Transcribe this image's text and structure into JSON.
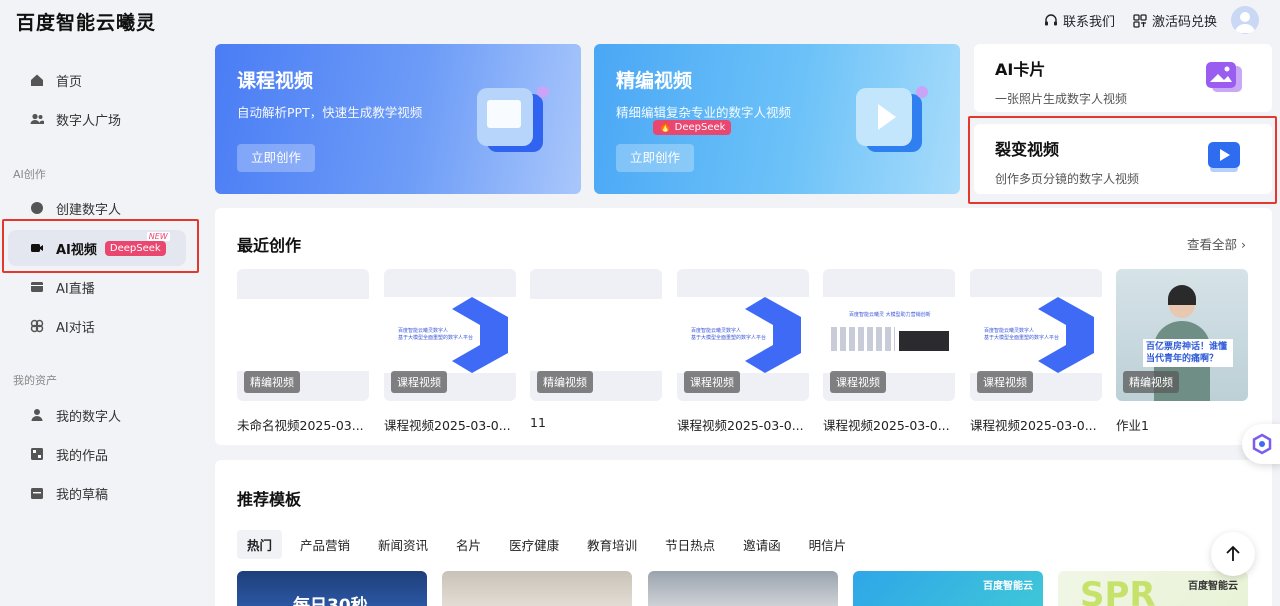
{
  "header": {
    "logo": "百度智能云曦灵",
    "contact": "联系我们",
    "redeem": "激活码兑换"
  },
  "sidebar": {
    "items": [
      {
        "label": "首页",
        "icon": "home-icon"
      },
      {
        "label": "数字人广场",
        "icon": "people-icon"
      }
    ],
    "group_ai": "AI创作",
    "ai_items": [
      {
        "label": "创建数字人",
        "icon": "circle-icon"
      },
      {
        "label": "AI视频",
        "icon": "video-icon",
        "badge": "DeepSeek",
        "badge_new": "NEW"
      },
      {
        "label": "AI直播",
        "icon": "live-icon"
      },
      {
        "label": "AI对话",
        "icon": "chat-icon"
      }
    ],
    "group_assets": "我的资产",
    "asset_items": [
      {
        "label": "我的数字人",
        "icon": "user-icon"
      },
      {
        "label": "我的作品",
        "icon": "works-icon"
      },
      {
        "label": "我的草稿",
        "icon": "draft-icon"
      }
    ]
  },
  "cards": {
    "course": {
      "title": "课程视频",
      "subtitle": "自动解析PPT，快速生成教学视频",
      "button": "立即创作"
    },
    "edit": {
      "title": "精编视频",
      "subtitle": "精细编辑复杂专业的数字人视频",
      "badge": "DeepSeek",
      "button": "立即创作"
    },
    "ai_card": {
      "title": "AI卡片",
      "subtitle": "一张照片生成数字人视频"
    },
    "fission": {
      "title": "裂变视频",
      "subtitle": "创作多页分镜的数字人视频"
    }
  },
  "recent": {
    "title": "最近创作",
    "view_all": "查看全部",
    "items": [
      {
        "tag": "精编视频",
        "name": "未命名视频2025-03..."
      },
      {
        "tag": "课程视频",
        "name": "课程视频2025-03-0..."
      },
      {
        "tag": "精编视频",
        "name": "11"
      },
      {
        "tag": "课程视频",
        "name": "课程视频2025-03-0..."
      },
      {
        "tag": "课程视频",
        "name": "课程视频2025-03-0..."
      },
      {
        "tag": "课程视频",
        "name": "课程视频2025-03-0..."
      },
      {
        "tag": "精编视频",
        "name": "作业1"
      }
    ],
    "thumb_caption": "百度智能云曦灵数字人\n基于大模型全面重塑的数字人平台",
    "thumb_caption2": "百度智能云曦灵 大模型助力营销创新",
    "person_caption": "百亿票房神话！谁懂\n当代青年的痛啊？"
  },
  "templates": {
    "title": "推荐模板",
    "tabs": [
      "热门",
      "产品营销",
      "新闻资讯",
      "名片",
      "医疗健康",
      "教育培训",
      "节日热点",
      "邀请函",
      "明信片"
    ],
    "tpl1_text": "每日30秒",
    "tpl4_brand": "百度智能云",
    "tpl5_text": "SPR",
    "tpl5_brand": "百度智能云"
  },
  "colors": {
    "accent": "#3e6af6",
    "deepseek": "#e9476f",
    "highlight": "#e3382e"
  }
}
